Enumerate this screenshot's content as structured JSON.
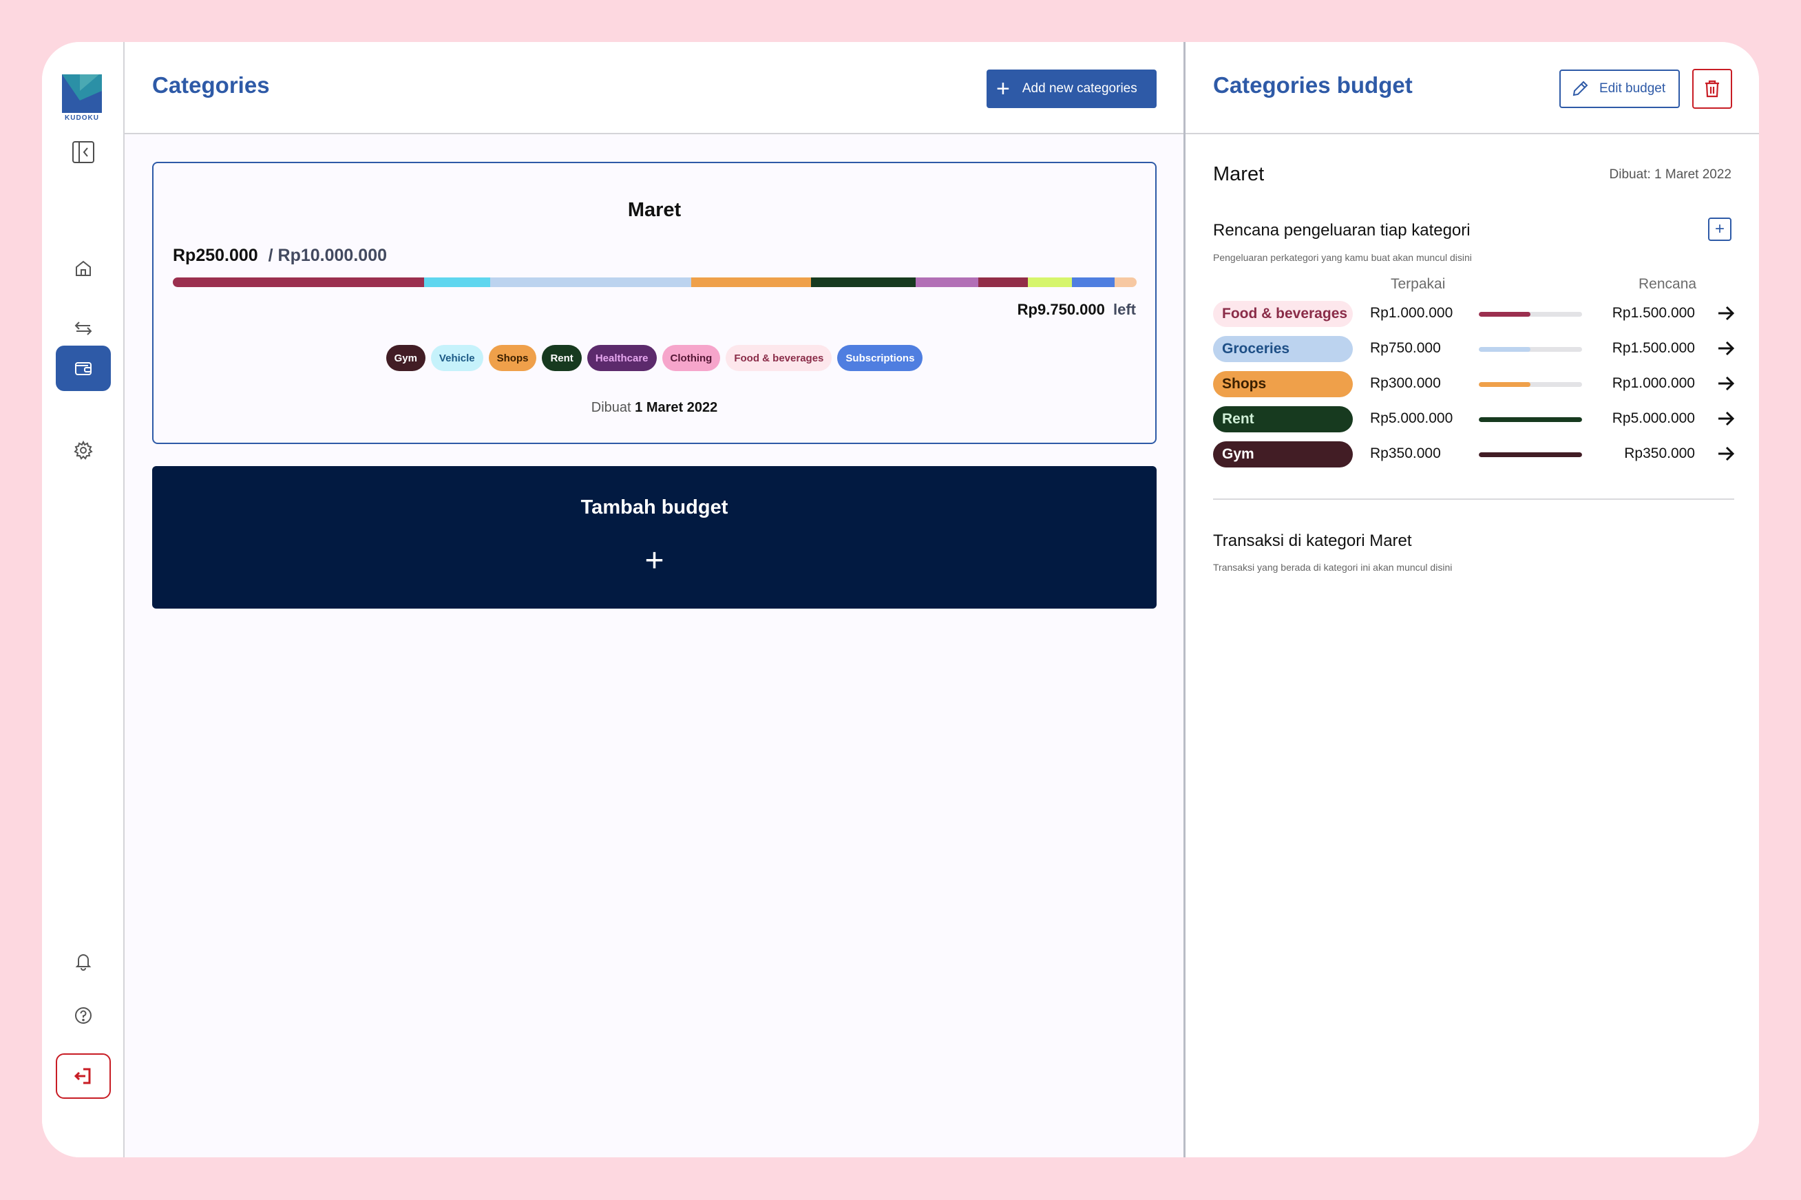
{
  "brand": {
    "name": "KUDOKU"
  },
  "sidebar": {
    "items": [
      {
        "name": "home-icon"
      },
      {
        "name": "transactions-icon"
      },
      {
        "name": "wallet-icon",
        "active": true
      },
      {
        "name": "gear-icon"
      }
    ],
    "bottom": [
      {
        "name": "bell-icon"
      },
      {
        "name": "help-icon"
      },
      {
        "name": "logout-icon"
      }
    ]
  },
  "main": {
    "title": "Categories",
    "add_label": "Add new categories",
    "budget": {
      "month": "Maret",
      "spent": "Rp250.000",
      "total": "/ Rp10.000.000",
      "left_amount": "Rp9.750.000",
      "left_word": "left",
      "created_prefix": "Dibuat",
      "created_date": "1 Maret 2022",
      "bar_segments": [
        {
          "color": "#9b2f4f",
          "share": 0.261
        },
        {
          "color": "#5fd6ef",
          "share": 0.068
        },
        {
          "color": "#bcd3ef",
          "share": 0.209
        },
        {
          "color": "#efa04a",
          "share": 0.124
        },
        {
          "color": "#173a1f",
          "share": 0.109
        },
        {
          "color": "#b26fb6",
          "share": 0.065
        },
        {
          "color": "#922d48",
          "share": 0.051
        },
        {
          "color": "#d6f56c",
          "share": 0.046
        },
        {
          "color": "#4f7ee0",
          "share": 0.044
        },
        {
          "color": "#f7c8a2",
          "share": 0.023
        }
      ],
      "chips": [
        {
          "label": "Gym",
          "bg": "#421d25",
          "fg": "#ffffff"
        },
        {
          "label": "Vehicle",
          "bg": "#c6f2fb",
          "fg": "#1c5a86"
        },
        {
          "label": "Shops",
          "bg": "#efa04a",
          "fg": "#3b2000"
        },
        {
          "label": "Rent",
          "bg": "#173a1f",
          "fg": "#ffffff"
        },
        {
          "label": "Healthcare",
          "bg": "#5c2a6c",
          "fg": "#e6a7ee"
        },
        {
          "label": "Clothing",
          "bg": "#f6a5cb",
          "fg": "#541735"
        },
        {
          "label": "Food & beverages",
          "bg": "#fde7ec",
          "fg": "#8a2c48"
        },
        {
          "label": "Subscriptions",
          "bg": "#4f7ee0",
          "fg": "#ffffff"
        }
      ]
    },
    "add_budget": {
      "title": "Tambah budget",
      "plus": "+"
    }
  },
  "panel": {
    "title": "Categories budget",
    "edit_label": "Edit budget",
    "month": "Maret",
    "created": "Dibuat: 1 Maret 2022",
    "plan_title": "Rencana pengeluaran tiap kategori",
    "plan_sub": "Pengeluaran perkategori yang kamu buat akan muncul disini",
    "col_used": "Terpakai",
    "col_plan": "Rencana",
    "rows": [
      {
        "label": "Food & beverages",
        "used": "Rp1.000.000",
        "plan": "Rp1.500.000",
        "progress": 0.5,
        "bg": "#fde7ec",
        "fg": "#8a2c48",
        "bar": "#9b2f4f"
      },
      {
        "label": "Groceries",
        "used": "Rp750.000",
        "plan": "Rp1.500.000",
        "progress": 0.5,
        "bg": "#bcd3ef",
        "fg": "#1e4f86",
        "bar": "#bcd3ef"
      },
      {
        "label": "Shops",
        "used": "Rp300.000",
        "plan": "Rp1.000.000",
        "progress": 0.5,
        "bg": "#efa04a",
        "fg": "#3b2000",
        "bar": "#efa04a"
      },
      {
        "label": "Rent",
        "used": "Rp5.000.000",
        "plan": "Rp5.000.000",
        "progress": 1.0,
        "bg": "#173a1f",
        "fg": "#cfeed6",
        "bar": "#173a1f"
      },
      {
        "label": "Gym",
        "used": "Rp350.000",
        "plan": "Rp350.000",
        "progress": 1.0,
        "bg": "#421d25",
        "fg": "#ffffff",
        "bar": "#421d25"
      }
    ],
    "tx_title": "Transaksi di kategori Maret",
    "tx_sub": "Transaksi yang berada di kategori ini akan muncul disini"
  },
  "colors": {
    "accent": "#2e5aa7",
    "danger": "#c81d25",
    "dark": "#021a41",
    "background": "#fdd8e0"
  }
}
